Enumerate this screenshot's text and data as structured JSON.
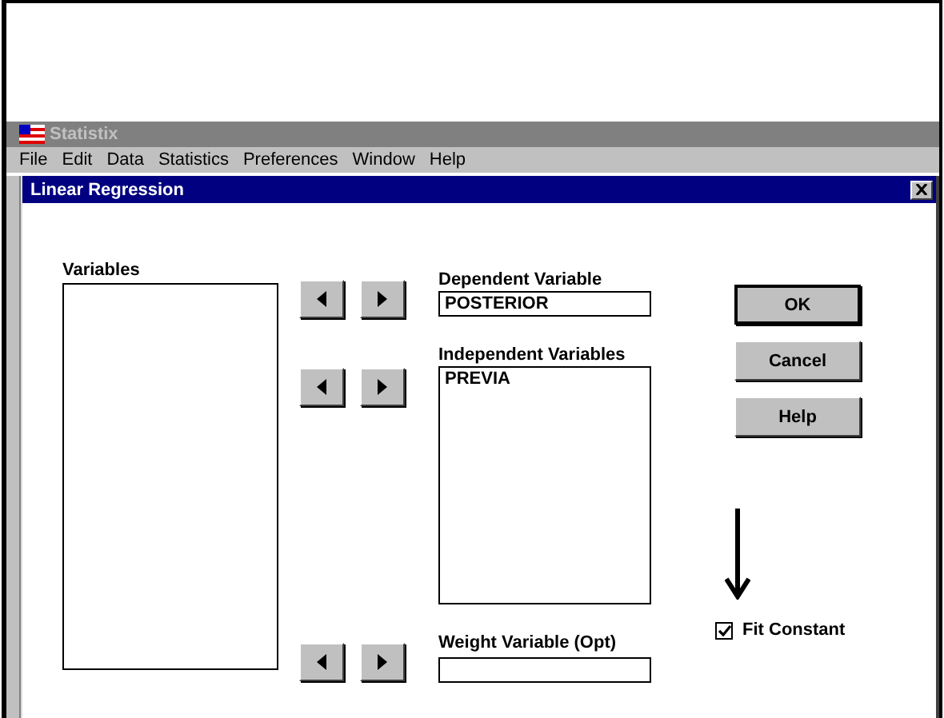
{
  "app": {
    "title": "Statistix",
    "menu": [
      {
        "label": "File"
      },
      {
        "label": "Edit"
      },
      {
        "label": "Data"
      },
      {
        "label": "Statistics"
      },
      {
        "label": "Preferences"
      },
      {
        "label": "Window"
      },
      {
        "label": "Help"
      }
    ]
  },
  "dialog": {
    "title": "Linear Regression",
    "variables": {
      "label": "Variables"
    },
    "dependent": {
      "label": "Dependent Variable",
      "value": "POSTERIOR"
    },
    "independent": {
      "label": "Independent Variables",
      "items": [
        "PREVIA"
      ]
    },
    "weight": {
      "label": "Weight Variable (Opt)"
    },
    "buttons": [
      {
        "label": "OK",
        "default": true
      },
      {
        "label": "Cancel",
        "default": false
      },
      {
        "label": "Help",
        "default": false
      }
    ],
    "fit_constant": {
      "label": "Fit Constant",
      "checked": true
    }
  }
}
